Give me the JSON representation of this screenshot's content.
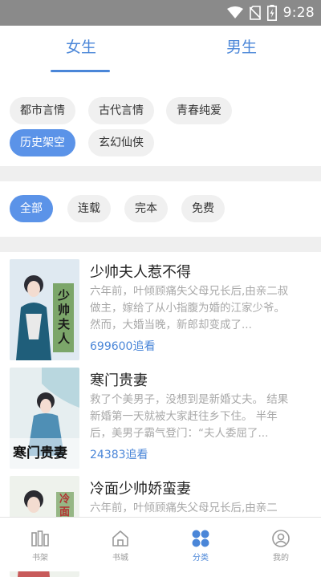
{
  "status_bar": {
    "time": "9:28"
  },
  "tabs": [
    {
      "label": "女生"
    },
    {
      "label": "男生"
    }
  ],
  "category_chips": [
    {
      "label": "都市言情"
    },
    {
      "label": "古代言情"
    },
    {
      "label": "青春纯爱"
    },
    {
      "label": "历史架空",
      "selected": true
    },
    {
      "label": "玄幻仙侠"
    }
  ],
  "status_chips": [
    {
      "label": "全部",
      "selected": true
    },
    {
      "label": "连载"
    },
    {
      "label": "完本"
    },
    {
      "label": "免费"
    }
  ],
  "books": [
    {
      "title": "少帅夫人惹不得",
      "description": "六年前，叶倾顾痛失父母兄长后,由亲二叔做主，嫁给了从小指腹为婚的江家少爷。  然而，大婚当晚，新郎却变成了...",
      "count": "699600追看",
      "cover_text": "少帅夫人"
    },
    {
      "title": "寒门贵妻",
      "description": "救了个美男子，没想到是新婚丈夫。 结果新婚第一天就被大家赶往乡下住。 半年后，美男子霸气登门：“夫人委屈了...",
      "count": "24383追看",
      "cover_text": "寒门贵妻"
    },
    {
      "title": "冷面少帅娇蛮妻",
      "description": "六年前，叶倾顾痛失父母兄长后,由亲二",
      "count": "",
      "cover_text": "冷面"
    }
  ],
  "bottom_nav": [
    {
      "label": "书架",
      "icon": "bookshelf-icon"
    },
    {
      "label": "书城",
      "icon": "home-icon"
    },
    {
      "label": "分类",
      "icon": "category-icon",
      "active": true
    },
    {
      "label": "我的",
      "icon": "profile-icon"
    }
  ],
  "colors": {
    "accent": "#4a86d8",
    "chip_active": "#5b93e8",
    "status_bar": "#8a8a8a"
  }
}
